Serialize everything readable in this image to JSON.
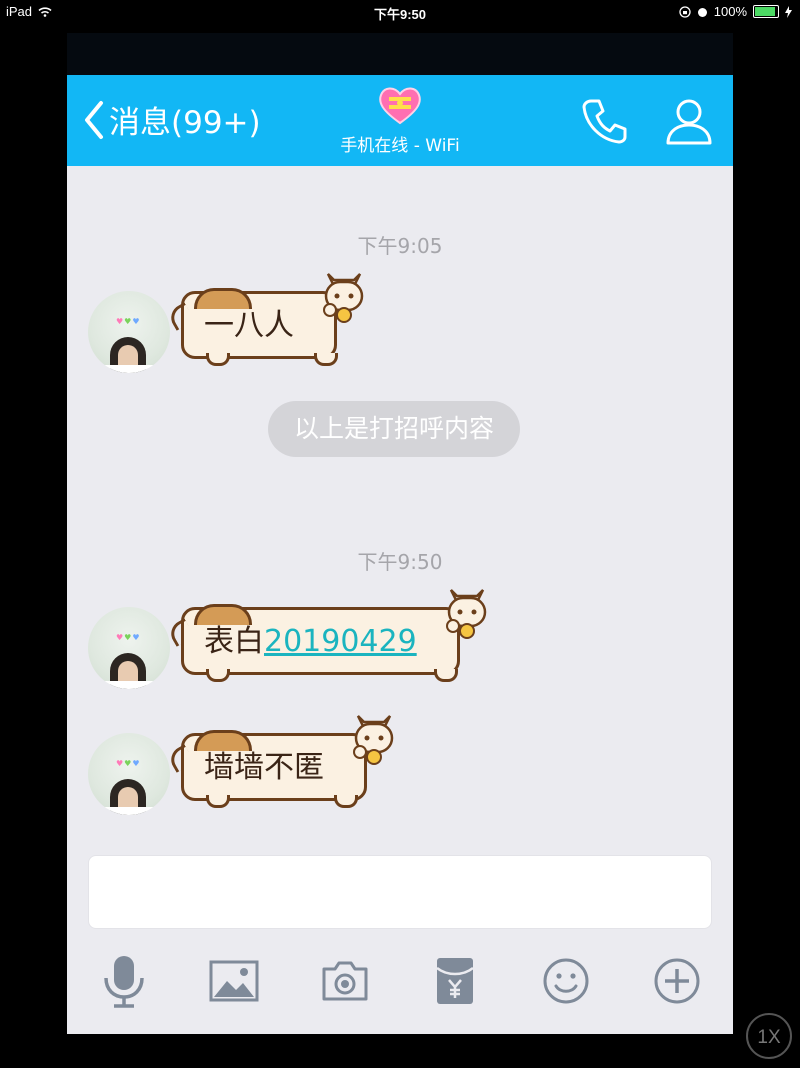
{
  "status_bar": {
    "device": "iPad",
    "time": "下午9:50",
    "battery": "100%"
  },
  "nav": {
    "back_label": "消息(99+)",
    "status": "手机在线 - WiFi"
  },
  "messages": [
    {
      "time": "下午9:05",
      "text": "一八人"
    },
    {
      "system": "以上是打招呼内容"
    },
    {
      "time": "下午9:50",
      "text_prefix": "表白",
      "link": "20190429"
    },
    {
      "text": "墙墙不匿"
    }
  ],
  "input": {
    "placeholder": ""
  },
  "toolbar": [
    "microphone-icon",
    "image-icon",
    "camera-icon",
    "red-packet-icon",
    "emoji-icon",
    "plus-icon"
  ],
  "zoom_label": "1X",
  "colors": {
    "nav": "#12b7f5",
    "link": "#1bb4bf",
    "bubble_border": "#6b3f1b"
  }
}
